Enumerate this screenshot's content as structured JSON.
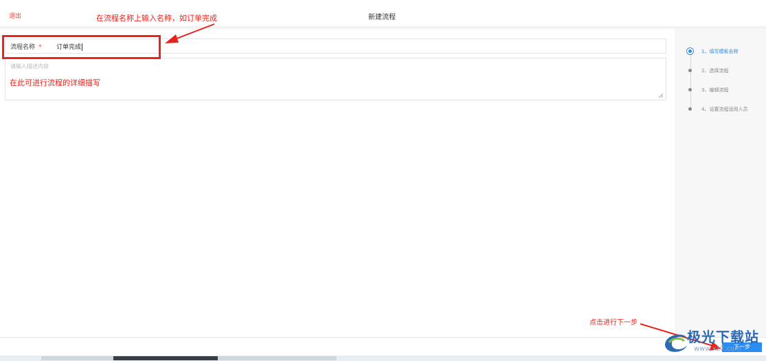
{
  "header": {
    "exit_label": "退出",
    "title": "新建流程"
  },
  "form": {
    "name_label": "流程名称",
    "required_mark": "*",
    "name_value": "订单完成",
    "description_placeholder": "请输入描述内容"
  },
  "steps": [
    {
      "label": "1、填写模板名称",
      "active": true
    },
    {
      "label": "2、选择流程",
      "active": false
    },
    {
      "label": "3、编辑流程",
      "active": false
    },
    {
      "label": "4、设置流程适用人员",
      "active": false
    }
  ],
  "footer": {
    "next_label": "下一步"
  },
  "annotations": {
    "name_hint": "在流程名称上输入名称，如订单完成",
    "description_hint": "在此可进行流程的详细描写",
    "next_hint": "点击进行下一步"
  },
  "watermark": {
    "brand": "极光下载站",
    "url": "www.xz7.com"
  },
  "colors": {
    "accent": "#2d8cf0",
    "annotation": "#e8231e"
  }
}
